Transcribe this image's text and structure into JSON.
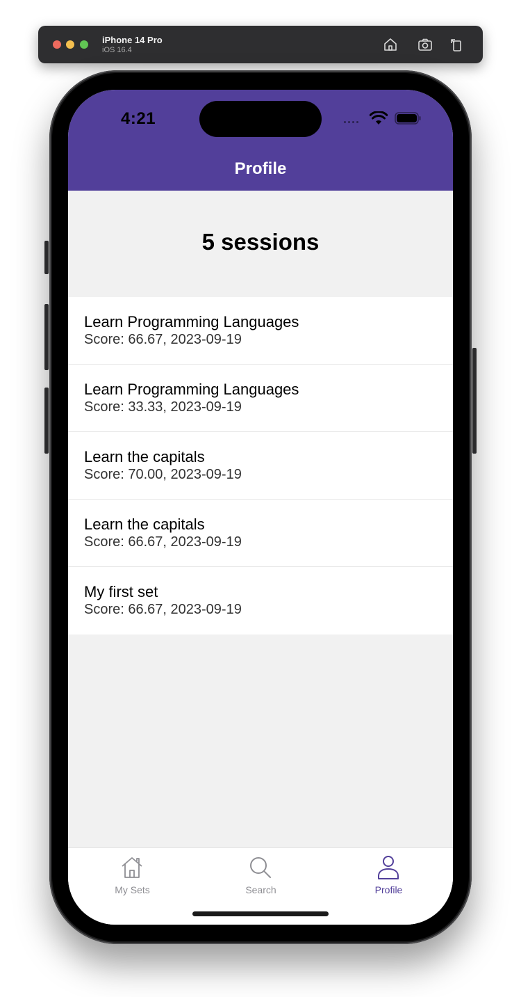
{
  "simulator": {
    "device_name": "iPhone 14 Pro",
    "os_version": "iOS 16.4",
    "buttons": [
      "home-icon",
      "screenshot-icon",
      "rotate-icon"
    ]
  },
  "status_bar": {
    "time": "4:21"
  },
  "nav": {
    "title": "Profile"
  },
  "summary": {
    "sessions_label": "5 sessions"
  },
  "sessions": [
    {
      "title": "Learn Programming Languages",
      "subtitle": "Score: 66.67, 2023-09-19"
    },
    {
      "title": "Learn Programming Languages",
      "subtitle": "Score: 33.33, 2023-09-19"
    },
    {
      "title": "Learn the capitals",
      "subtitle": "Score: 70.00, 2023-09-19"
    },
    {
      "title": "Learn the capitals",
      "subtitle": "Score: 66.67, 2023-09-19"
    },
    {
      "title": "My first set",
      "subtitle": "Score: 66.67, 2023-09-19"
    }
  ],
  "tabs": [
    {
      "label": "My Sets",
      "icon": "house-icon",
      "active": false
    },
    {
      "label": "Search",
      "icon": "magnifier-icon",
      "active": false
    },
    {
      "label": "Profile",
      "icon": "person-icon",
      "active": true
    }
  ],
  "colors": {
    "accent": "#523f9a",
    "background": "#f1f1f1",
    "inactive_tab": "#8e8e93"
  }
}
